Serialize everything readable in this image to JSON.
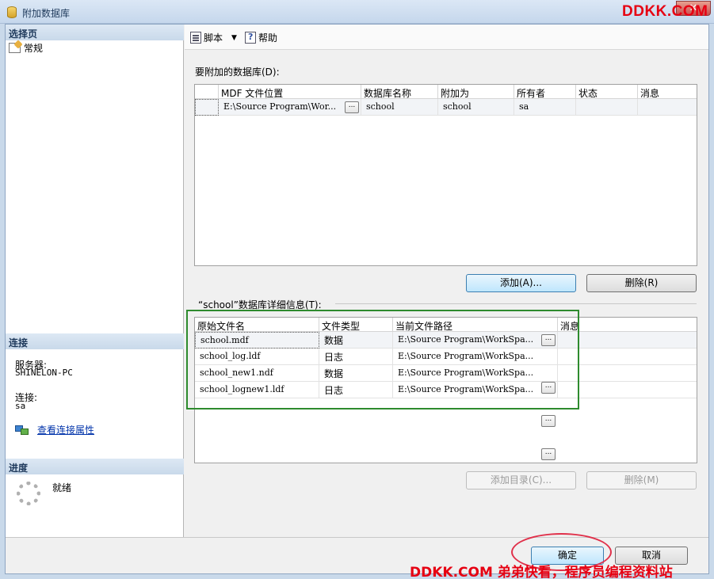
{
  "window": {
    "title": "附加数据库",
    "close_label": "✕"
  },
  "watermark": {
    "top": "DDKK.COM",
    "bottom": "DDKK.COM 弟弟快看，程序员编程资料站"
  },
  "left_panel": {
    "select_page_header": "选择页",
    "nav_items": [
      {
        "label": "常规",
        "icon": "page-settings-icon"
      }
    ],
    "connection_header": "连接",
    "server_label": "服务器:",
    "server_value": "SHINELON-PC",
    "connection_label": "连接:",
    "connection_value": "sa",
    "view_connection_link": "查看连接属性",
    "progress_header": "进度",
    "progress_status": "就绪"
  },
  "toolbar": {
    "script_label": "脚本",
    "help_label": "帮助"
  },
  "attach_section": {
    "label": "要附加的数据库(D):",
    "columns": [
      "MDF 文件位置",
      "数据库名称",
      "附加为",
      "所有者",
      "状态",
      "消息"
    ],
    "rows": [
      {
        "mdf": "E:\\Source Program\\Wor...",
        "db_name": "school",
        "attach_as": "school",
        "owner": "sa",
        "status": "",
        "message": ""
      }
    ],
    "add_button": "添加(A)...",
    "remove_button": "删除(R)"
  },
  "details_section": {
    "label": "“school”数据库详细信息(T):",
    "columns": [
      "原始文件名",
      "文件类型",
      "当前文件路径",
      "消息"
    ],
    "rows": [
      {
        "file": "school.mdf",
        "type": "数据",
        "path": "E:\\Source Program\\WorkSpa..."
      },
      {
        "file": "school_log.ldf",
        "type": "日志",
        "path": "E:\\Source Program\\WorkSpa..."
      },
      {
        "file": "school_new1.ndf",
        "type": "数据",
        "path": "E:\\Source Program\\WorkSpa..."
      },
      {
        "file": "school_lognew1.ldf",
        "type": "日志",
        "path": "E:\\Source Program\\WorkSpa..."
      }
    ],
    "add_catalog_button": "添加目录(C)...",
    "remove_button": "删除(M)"
  },
  "footer": {
    "ok_button": "确定",
    "cancel_button": "取消"
  }
}
